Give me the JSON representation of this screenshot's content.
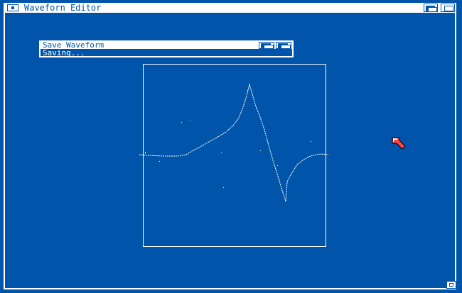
{
  "window": {
    "title": "Waveforn Editor"
  },
  "dialog": {
    "title": "Save Waveform",
    "status": "Saving..."
  },
  "icons": {
    "close": "close-icon",
    "depth": "depth-arrange-icon",
    "zoom": "zoom-icon",
    "resize": "resize-icon",
    "pointer": "mouse-pointer-icon"
  },
  "colors": {
    "background": "#0055aa",
    "foreground": "#ffffff",
    "pointer": "#ff4444"
  }
}
